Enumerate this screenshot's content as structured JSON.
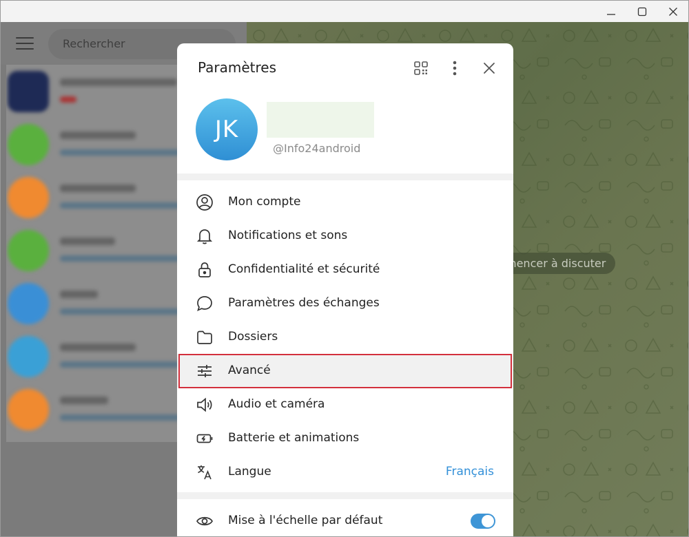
{
  "window": {
    "controls": {
      "minimize": "minimize-icon",
      "maximize": "maximize-icon",
      "close": "close-icon"
    }
  },
  "sidebar": {
    "search_placeholder": "Rechercher",
    "chat_avatar_colors": [
      "#1e2a55",
      "#5ab03e",
      "#f08a30",
      "#5ab03e",
      "#3a8fd6",
      "#3aa0d6",
      "#f08a30"
    ]
  },
  "chat": {
    "hint": "mencer à discuter"
  },
  "settings": {
    "title": "Paramètres",
    "profile": {
      "initials": "JK",
      "username": "@Info24android"
    },
    "items": [
      {
        "label": "Mon compte",
        "icon": "user-circle-icon"
      },
      {
        "label": "Notifications et sons",
        "icon": "bell-icon"
      },
      {
        "label": "Confidentialité et sécurité",
        "icon": "lock-icon"
      },
      {
        "label": "Paramètres des échanges",
        "icon": "chat-bubble-icon"
      },
      {
        "label": "Dossiers",
        "icon": "folder-icon"
      },
      {
        "label": "Avancé",
        "icon": "sliders-icon"
      },
      {
        "label": "Audio et caméra",
        "icon": "speaker-icon"
      },
      {
        "label": "Batterie et animations",
        "icon": "battery-icon"
      },
      {
        "label": "Langue",
        "icon": "translate-icon",
        "value": "Français"
      }
    ],
    "scale_item": {
      "label": "Mise à l'échelle par défaut",
      "icon": "eye-icon",
      "enabled": true
    },
    "accent_color": "#3390d8",
    "highlight_color": "#d32f3c"
  }
}
